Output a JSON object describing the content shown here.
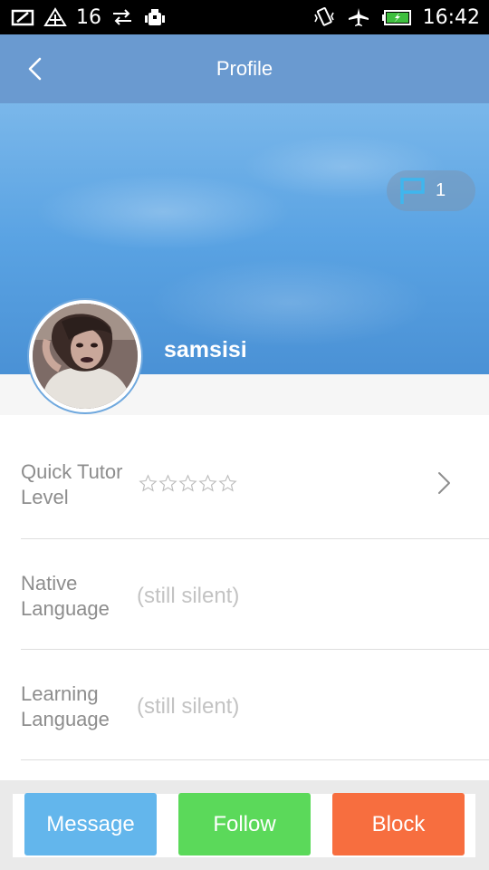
{
  "status_bar": {
    "notification_count": "16",
    "time": "16:42",
    "icons": [
      "notes-icon",
      "wifi-icon",
      "sync-icon",
      "android-debug-icon",
      "vibrate-icon",
      "airplane-mode-icon",
      "battery-charging-icon"
    ]
  },
  "header": {
    "title": "Profile",
    "back_icon": "chevron-left-icon"
  },
  "profile": {
    "username": "samsisi",
    "flag_count": "1",
    "flag_icon": "flag-icon"
  },
  "info_rows": [
    {
      "label": "Quick Tutor Level",
      "value": "",
      "stars": 5,
      "stars_filled": 0,
      "has_chevron": true
    },
    {
      "label": "Native Language",
      "value": "(still silent)"
    },
    {
      "label": "Learning Language",
      "value": "(still silent)"
    }
  ],
  "actions": {
    "message": "Message",
    "follow": "Follow",
    "block": "Block"
  },
  "colors": {
    "header_bg": "#6a9ad0",
    "message": "#63b6ec",
    "follow": "#5bd95a",
    "block": "#f76e3f",
    "label": "#8d8d8d",
    "value": "#c3c3c3"
  }
}
